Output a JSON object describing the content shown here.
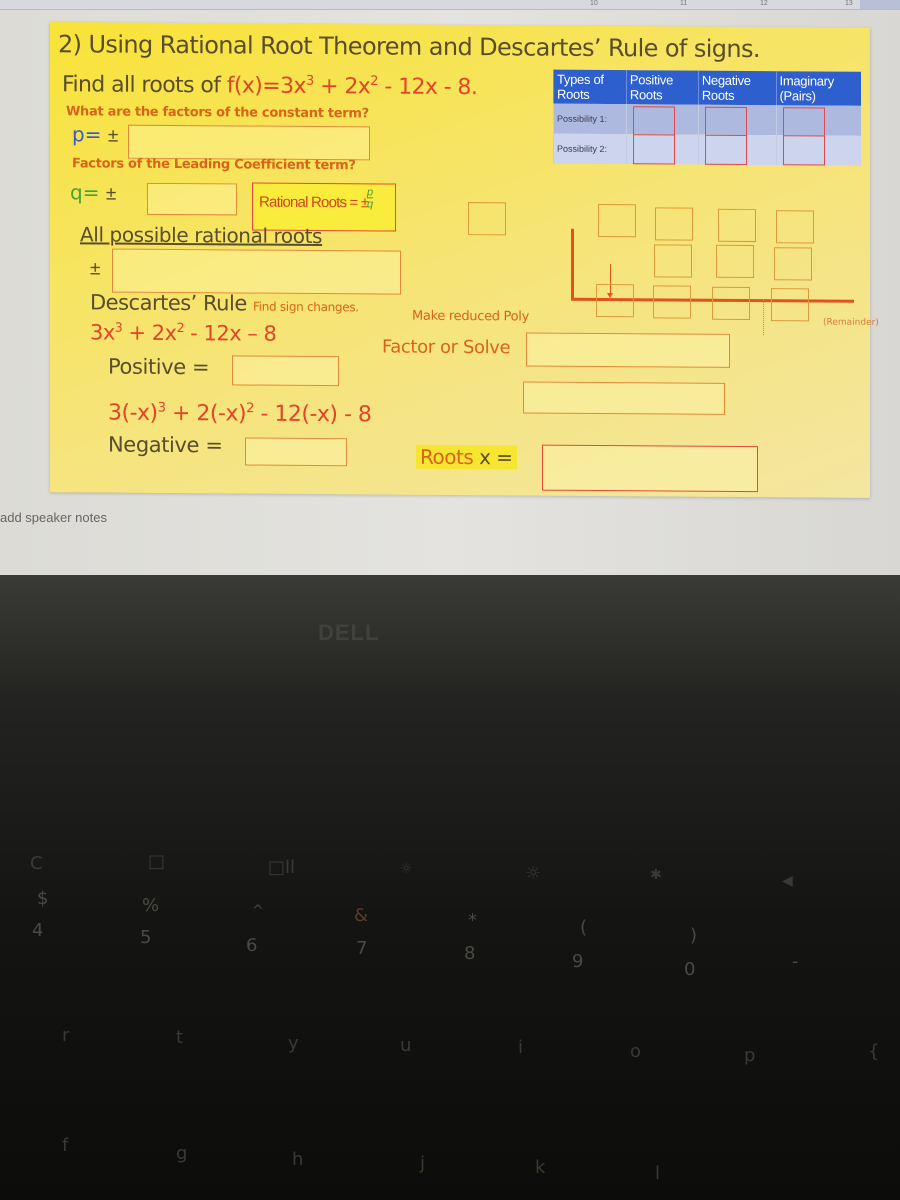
{
  "slide": {
    "title": "2) Using Rational Root Theorem and Descartes’ Rule of signs.",
    "find_prefix": "Find all roots of ",
    "function_label": "f(x)=3x³ + 2x² - 12x - 8.",
    "function_parts": {
      "a": "f(x)=3x",
      "b": "3",
      "c": " + 2x",
      "d": "2",
      "e": " - 12x - 8."
    },
    "constant_question": "What are the factors of the constant term?",
    "p_label": "p= ",
    "pm": "±",
    "leading_question": "Factors of the Leading Coefficient term?",
    "q_label": "q=  ",
    "rational_roots_label": "Rational Roots = ±",
    "frac_num": "p",
    "frac_den": "q",
    "all_roots_label": "All possible rational roots",
    "descartes_label": "Descartes’ Rule",
    "find_sign_changes": "Find sign changes.",
    "poly_pos": {
      "a": "3x",
      "b": "3",
      "c": " + 2x",
      "d": "2",
      "e": " - 12x – 8"
    },
    "positive_label": "Positive =",
    "poly_neg": {
      "a": "3(-x)",
      "b": "3",
      "c": " + 2(-x)",
      "d": "2",
      "e": " - 12(-x) - 8"
    },
    "negative_label": "Negative =",
    "make_reduced_poly": "Make reduced Poly",
    "factor_or_solve": "Factor or Solve",
    "roots_label": "Roots",
    "roots_x": " x =",
    "remainder_label": "(Remainder)"
  },
  "roots_table": {
    "headers": [
      "Types of Roots",
      "Positive Roots",
      "Negative Roots",
      "Imaginary (Pairs)"
    ],
    "rows": [
      {
        "label": "Possibility 1:"
      },
      {
        "label": "Possibility 2:"
      }
    ]
  },
  "editor": {
    "speaker_notes_placeholder": "add speaker notes",
    "ruler_ticks": [
      "10",
      "11",
      "12",
      "13"
    ]
  },
  "keyboard": {
    "brand": "DELL",
    "fn_row": [
      "C",
      "□",
      "□ll",
      "☼",
      "☼",
      "✱",
      "◀"
    ],
    "num_symbols": [
      "$",
      "%",
      "^",
      "&",
      "*",
      "(",
      ")"
    ],
    "num_row": [
      "4",
      "5",
      "6",
      "7",
      "8",
      "9",
      "0",
      "-"
    ],
    "top_row": [
      "r",
      "t",
      "y",
      "u",
      "i",
      "o",
      "p",
      "{"
    ],
    "home_row": [
      "f",
      "g",
      "h",
      "j",
      "k",
      "l"
    ]
  }
}
